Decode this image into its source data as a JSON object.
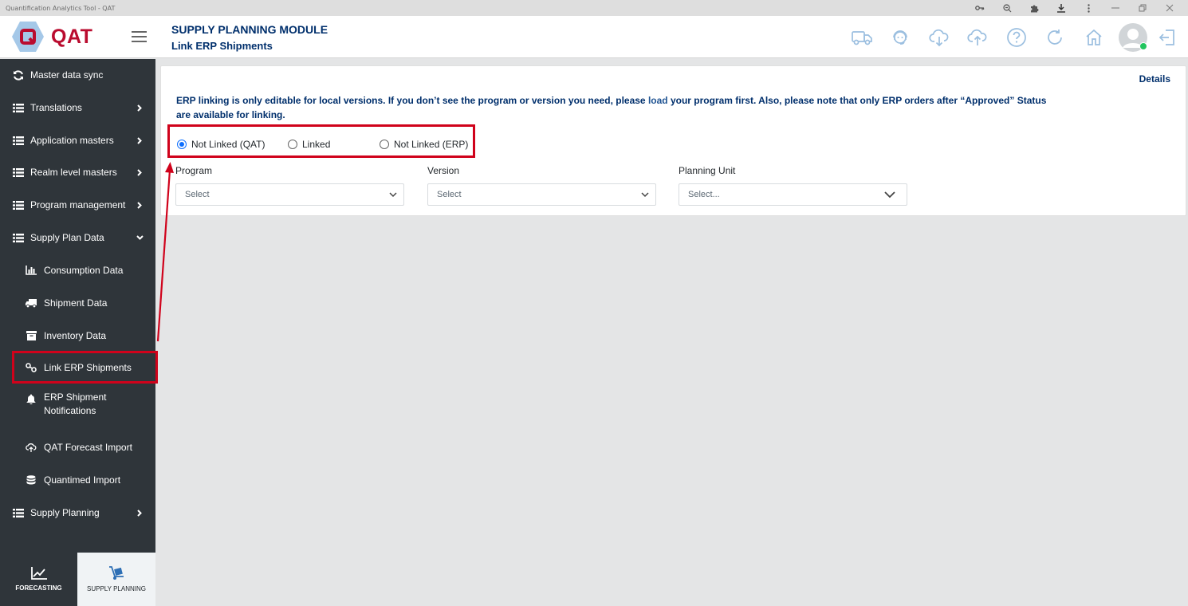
{
  "window": {
    "title": "Quantification Analytics Tool - QAT"
  },
  "window_icons": [
    "key-icon",
    "zoom-icon",
    "extension-icon",
    "download-icon",
    "more-icon",
    "minimize-icon",
    "restore-icon",
    "close-icon"
  ],
  "header": {
    "logo_text": "QAT",
    "module_title": "SUPPLY PLANNING MODULE",
    "page_title": "Link ERP Shipments",
    "icons": [
      "truck-icon",
      "support-agent-icon",
      "cloud-download-icon",
      "cloud-upload-icon",
      "help-icon",
      "refresh-icon",
      "home-icon",
      "user-avatar",
      "logout-icon"
    ]
  },
  "sidebar": {
    "items": [
      {
        "label": "Master data sync",
        "icon": "sync-icon"
      },
      {
        "label": "Translations",
        "icon": "list-icon"
      },
      {
        "label": "Application masters",
        "icon": "list-icon"
      },
      {
        "label": "Realm level masters",
        "icon": "list-icon"
      },
      {
        "label": "Program management",
        "icon": "list-icon"
      },
      {
        "label": "Supply Plan Data",
        "icon": "list-icon"
      },
      {
        "label": "Consumption Data",
        "icon": "bar-chart-icon"
      },
      {
        "label": "Shipment Data",
        "icon": "truck-icon"
      },
      {
        "label": "Inventory Data",
        "icon": "archive-icon"
      },
      {
        "label": "Link ERP Shipments",
        "icon": "link-icon"
      },
      {
        "label_line1": "ERP Shipment",
        "label_line2": "Notifications",
        "icon": "bell-icon"
      },
      {
        "label": "QAT Forecast Import",
        "icon": "cloud-upload-icon"
      },
      {
        "label": "Quantimed Import",
        "icon": "database-icon"
      },
      {
        "label": "Supply Planning",
        "icon": "list-icon"
      }
    ],
    "bottom_tabs": [
      {
        "label": "FORECASTING",
        "icon": "line-chart-icon"
      },
      {
        "label": "SUPPLY PLANNING",
        "icon": "hand-truck-icon"
      }
    ]
  },
  "main": {
    "details_link": "Details",
    "notice_part1": "ERP linking is only editable for local versions. If you don’t see the program or version you need, please ",
    "notice_link": "load",
    "notice_part2": " your program first. Also, please note that only ERP orders after “Approved” Status are available for linking.",
    "radio_options": [
      {
        "label": "Not Linked (QAT)",
        "selected": true
      },
      {
        "label": "Linked",
        "selected": false
      },
      {
        "label": "Not Linked (ERP)",
        "selected": false
      }
    ],
    "filters": [
      {
        "label": "Program",
        "value": "Select"
      },
      {
        "label": "Version",
        "value": "Select"
      },
      {
        "label": "Planning Unit",
        "value": "Select..."
      }
    ]
  },
  "colors": {
    "brand_red": "#ba0c2f",
    "navy": "#002f6c",
    "sidebar_bg": "#2f353a",
    "highlight_red": "#d0021b",
    "radio_blue": "#0d6efd"
  }
}
